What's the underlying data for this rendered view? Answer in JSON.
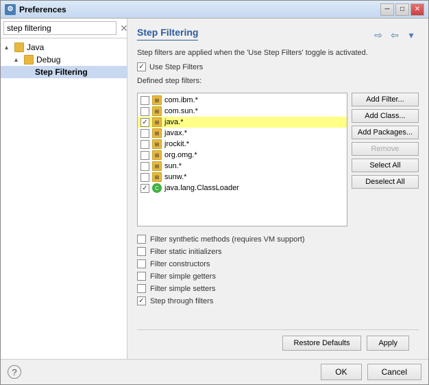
{
  "window": {
    "title": "Preferences",
    "icon": "⚙"
  },
  "sidebar": {
    "search_placeholder": "step filtering",
    "tree": [
      {
        "label": "Java",
        "level": 0,
        "arrow": "▸",
        "type": "folder"
      },
      {
        "label": "Debug",
        "level": 1,
        "arrow": "▸",
        "type": "folder"
      },
      {
        "label": "Step Filtering",
        "level": 2,
        "arrow": "",
        "type": "leaf",
        "selected": true
      }
    ]
  },
  "main": {
    "title": "Step Filtering",
    "description": "Step filters are applied when the 'Use Step Filters' toggle is activated.",
    "use_step_filters_label": "Use Step Filters",
    "use_step_filters_checked": true,
    "defined_label": "Defined step filters:",
    "filters": [
      {
        "checked": false,
        "name": "com.ibm.*",
        "highlighted": false,
        "icon": "pkg"
      },
      {
        "checked": false,
        "name": "com.sun.*",
        "highlighted": false,
        "icon": "pkg"
      },
      {
        "checked": true,
        "name": "java.*",
        "highlighted": true,
        "icon": "pkg"
      },
      {
        "checked": false,
        "name": "javax.*",
        "highlighted": false,
        "icon": "pkg"
      },
      {
        "checked": false,
        "name": "jrockit.*",
        "highlighted": false,
        "icon": "pkg"
      },
      {
        "checked": false,
        "name": "org.omg.*",
        "highlighted": false,
        "icon": "pkg"
      },
      {
        "checked": false,
        "name": "sun.*",
        "highlighted": false,
        "icon": "pkg"
      },
      {
        "checked": false,
        "name": "sunw.*",
        "highlighted": false,
        "icon": "pkg"
      },
      {
        "checked": true,
        "name": "java.lang.ClassLoader",
        "highlighted": false,
        "icon": "class"
      }
    ],
    "filter_buttons": [
      {
        "label": "Add Filter...",
        "disabled": false
      },
      {
        "label": "Add Class...",
        "disabled": false
      },
      {
        "label": "Add Packages...",
        "disabled": false
      },
      {
        "label": "Remove",
        "disabled": true
      },
      {
        "label": "Select All",
        "disabled": false
      },
      {
        "label": "Deselect All",
        "disabled": false
      }
    ],
    "extra_checkboxes": [
      {
        "label": "Filter synthetic methods (requires VM support)",
        "checked": false
      },
      {
        "label": "Filter static initializers",
        "checked": false
      },
      {
        "label": "Filter constructors",
        "checked": false
      },
      {
        "label": "Filter simple getters",
        "checked": false
      },
      {
        "label": "Filter simple setters",
        "checked": false
      },
      {
        "label": "Step through filters",
        "checked": true
      }
    ],
    "bottom_buttons": [
      {
        "label": "Restore Defaults"
      },
      {
        "label": "Apply"
      }
    ]
  },
  "dialog_footer": {
    "ok_label": "OK",
    "cancel_label": "Cancel"
  }
}
